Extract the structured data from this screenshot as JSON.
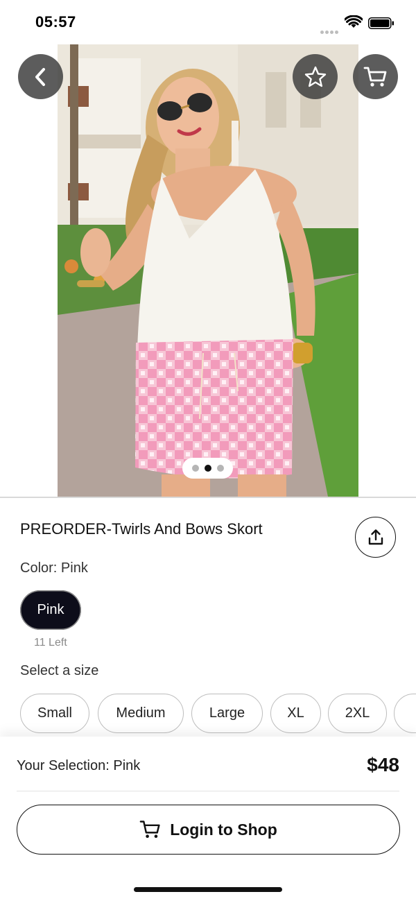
{
  "status_bar": {
    "time": "05:57"
  },
  "product": {
    "title": "PREORDER-Twirls And Bows Skort",
    "color_prefix": "Color: ",
    "color_value": "Pink",
    "colors": [
      {
        "label": "Pink",
        "stock": "11 Left",
        "selected": true
      }
    ],
    "size_prompt": "Select a size",
    "sizes": [
      "Small",
      "Medium",
      "Large",
      "XL",
      "2XL"
    ]
  },
  "gallery": {
    "pages": 3,
    "current_page": 2
  },
  "footer": {
    "selection_prefix": "Your Selection: ",
    "selection_value": "Pink",
    "price": "$48",
    "cta_label": "Login to Shop"
  },
  "icons": {
    "back": "chevron-left-icon",
    "favorite": "star-icon",
    "cart": "cart-icon",
    "share": "share-icon",
    "cta": "cart-icon"
  },
  "colors": {
    "chip_selected": "#0d0d1a",
    "button_overlay": "#404040",
    "text_primary": "#111111",
    "text_muted": "#8a8a8a"
  }
}
